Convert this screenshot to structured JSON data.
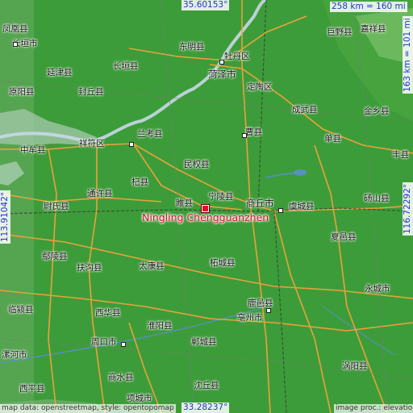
{
  "map": {
    "main_place": "Ningling Chengguanzhen",
    "coords": {
      "north": "35.60153°",
      "south": "33.28237°",
      "west": "113.91042°",
      "east": "116.72292°"
    },
    "scale": {
      "top": "258 km = 160 mi",
      "right": "163 km = 101 mi"
    },
    "attribution": {
      "left": "map data: openstreetmap, style: opentopomap",
      "right": "image proc.: elevationmap"
    },
    "places": [
      {
        "name": "范县",
        "kind": "town"
      },
      {
        "name": "凤凰县",
        "kind": "town"
      },
      {
        "name": "长垣市",
        "kind": "town"
      },
      {
        "name": "东明县",
        "kind": "town"
      },
      {
        "name": "牡丹区",
        "kind": "town"
      },
      {
        "name": "巨野县",
        "kind": "town"
      },
      {
        "name": "嘉祥县",
        "kind": "town"
      },
      {
        "name": "延津县",
        "kind": "town"
      },
      {
        "name": "长垣县",
        "kind": "town"
      },
      {
        "name": "菏泽市",
        "kind": "city"
      },
      {
        "name": "原阳县",
        "kind": "town"
      },
      {
        "name": "封丘县",
        "kind": "town"
      },
      {
        "name": "定陶区",
        "kind": "town"
      },
      {
        "name": "成武县",
        "kind": "town"
      },
      {
        "name": "金乡县",
        "kind": "town"
      },
      {
        "name": "兰考县",
        "kind": "town"
      },
      {
        "name": "曹县",
        "kind": "town"
      },
      {
        "name": "单县",
        "kind": "town"
      },
      {
        "name": "中牟县",
        "kind": "town"
      },
      {
        "name": "祥符区",
        "kind": "town"
      },
      {
        "name": "民权县",
        "kind": "town"
      },
      {
        "name": "丰县",
        "kind": "town"
      },
      {
        "name": "杞县",
        "kind": "town"
      },
      {
        "name": "通许县",
        "kind": "town"
      },
      {
        "name": "睢县",
        "kind": "town"
      },
      {
        "name": "宁陵县",
        "kind": "town"
      },
      {
        "name": "商丘市",
        "kind": "city"
      },
      {
        "name": "尉氏县",
        "kind": "town"
      },
      {
        "name": "虞城县",
        "kind": "town"
      },
      {
        "name": "砀山县",
        "kind": "town"
      },
      {
        "name": "柘城县",
        "kind": "town"
      },
      {
        "name": "夏邑县",
        "kind": "town"
      },
      {
        "name": "鄢陵县",
        "kind": "town"
      },
      {
        "name": "扶沟县",
        "kind": "town"
      },
      {
        "name": "太康县",
        "kind": "town"
      },
      {
        "name": "永城市",
        "kind": "town"
      },
      {
        "name": "临颍县",
        "kind": "town"
      },
      {
        "name": "西华县",
        "kind": "town"
      },
      {
        "name": "鹿邑县",
        "kind": "town"
      },
      {
        "name": "淮阳县",
        "kind": "town"
      },
      {
        "name": "亳州市",
        "kind": "town"
      },
      {
        "name": "郸城县",
        "kind": "town"
      },
      {
        "name": "漯河市",
        "kind": "town"
      },
      {
        "name": "周口市",
        "kind": "town"
      },
      {
        "name": "涡阳县",
        "kind": "town"
      },
      {
        "name": "商水县",
        "kind": "town"
      },
      {
        "name": "西平县",
        "kind": "town"
      },
      {
        "name": "项城市",
        "kind": "town"
      },
      {
        "name": "沈丘县",
        "kind": "town"
      },
      {
        "name": "瑞丽县",
        "kind": "town"
      },
      {
        "name": "新郑市",
        "kind": "town"
      },
      {
        "name": "许昌",
        "kind": "town"
      }
    ]
  }
}
